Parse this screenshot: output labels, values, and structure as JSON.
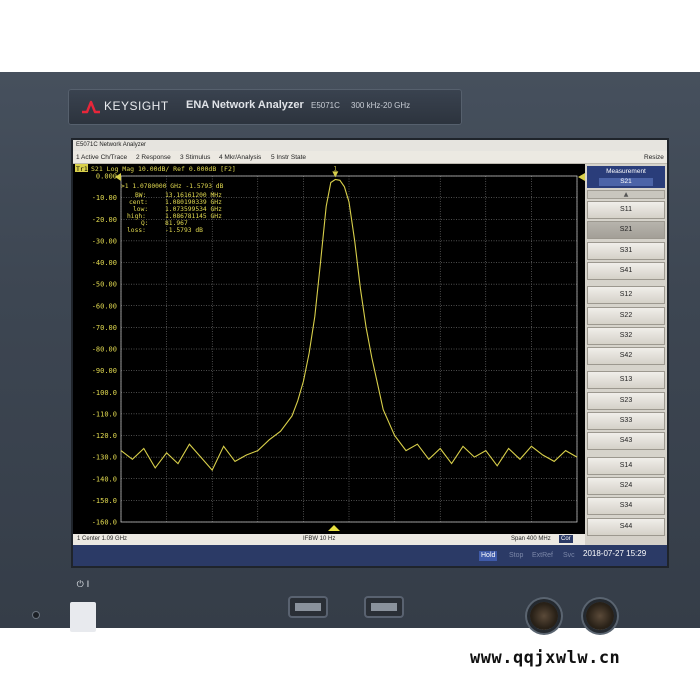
{
  "instrument": {
    "brand": "KEYSIGHT",
    "product": "ENA Network Analyzer",
    "model": "E5071C",
    "range": "300 kHz-20 GHz"
  },
  "window": {
    "title": "E5071C Network Analyzer",
    "resize_label": "Resize"
  },
  "menu": [
    "1 Active Ch/Trace",
    "2 Response",
    "3 Stimulus",
    "4 Mkr/Analysis",
    "5 Instr State"
  ],
  "trace_header": {
    "trace_id": "Tr1",
    "text": "S21 Log Mag 10.00dB/ Ref 0.000dB [F2]"
  },
  "marker_readout": {
    "line1": ">1  1.0780000 GHz -1.5793 dB",
    "labels": [
      "BW:",
      "cent:",
      "low:",
      "high:",
      "Q:",
      "loss:"
    ],
    "values": [
      "13.16161200 MHz",
      "1.080190339 GHz",
      "1.073599534 GHz",
      "1.086781145 GHz",
      "81.967",
      "-1.5793 dB"
    ]
  },
  "softkeys": {
    "title": "Measurement",
    "value": "S21",
    "selected": "S21",
    "items": [
      "S11",
      "S21",
      "S31",
      "S41",
      "S12",
      "S22",
      "S32",
      "S42",
      "S13",
      "S23",
      "S33",
      "S43",
      "S14",
      "S24",
      "S34",
      "S44"
    ]
  },
  "status": {
    "center": "1  Center 1.09 GHz",
    "ifbw": "IFBW 10 Hz",
    "span": "Span 400 MHz",
    "cor": "Cor"
  },
  "bottom": {
    "hold": "Hold",
    "stop": "Stop",
    "extref": "ExtRef",
    "svc": "Svc",
    "datetime": "2018-07-27 15:29"
  },
  "footer": {
    "url": "www.qqjxwlw.cn"
  },
  "colors": {
    "trace": "#d8cf4a",
    "grid": "#9a9a9a",
    "readout": "#e2da50",
    "softkey_header": "#2a3d7a"
  },
  "chart_data": {
    "type": "line",
    "title": "",
    "xlabel": "",
    "ylabel": "",
    "xlim": [
      0.89,
      1.29
    ],
    "ylim": [
      -160,
      0
    ],
    "x_unit": "GHz",
    "y_unit": "dB",
    "yticks": [
      "0.000",
      "-10.00",
      "-20.00",
      "-30.00",
      "-40.00",
      "-50.00",
      "-60.00",
      "-70.00",
      "-80.00",
      "-90.00",
      "-100.0",
      "-110.0",
      "-120.0",
      "-130.0",
      "-140.0",
      "-150.0",
      "-160.0"
    ],
    "series": [
      {
        "x": [
          0.89,
          0.9,
          0.91,
          0.92,
          0.93,
          0.94,
          0.95,
          0.96,
          0.97,
          0.98,
          0.99,
          1.0,
          1.01,
          1.02,
          1.03,
          1.04,
          1.045,
          1.05,
          1.055,
          1.06,
          1.065,
          1.07,
          1.074,
          1.078,
          1.082,
          1.086,
          1.09,
          1.095,
          1.1,
          1.105,
          1.11,
          1.115,
          1.12,
          1.13,
          1.14,
          1.15,
          1.16,
          1.17,
          1.18,
          1.19,
          1.2,
          1.21,
          1.22,
          1.23,
          1.24,
          1.25,
          1.26,
          1.27,
          1.28,
          1.29
        ],
        "values": [
          -127,
          -131,
          -126,
          -135,
          -128,
          -133,
          -124,
          -130,
          -136,
          -125,
          -132,
          -129,
          -127,
          -122,
          -118,
          -111,
          -104,
          -95,
          -82,
          -65,
          -40,
          -14,
          -3,
          -1.6,
          -2,
          -5,
          -12,
          -30,
          -52,
          -70,
          -84,
          -96,
          -108,
          -120,
          -127,
          -124,
          -131,
          -126,
          -133,
          -125,
          -130,
          -127,
          -134,
          -126,
          -131,
          -125,
          -129,
          -132,
          -127,
          -130
        ]
      }
    ],
    "markers": [
      {
        "x": 1.078,
        "y": -1.5793,
        "label": "1"
      }
    ],
    "grid": true
  }
}
